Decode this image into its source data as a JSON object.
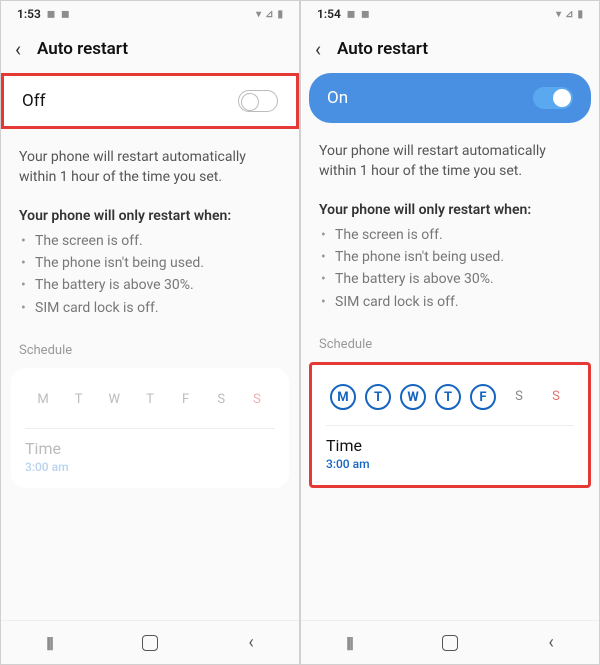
{
  "left": {
    "status_time": "1:53",
    "header_title": "Auto restart",
    "toggle_label": "Off",
    "description": "Your phone will restart automatically within 1 hour of the time you set.",
    "conditions_header": "Your phone will only restart when:",
    "conditions": [
      "The screen is off.",
      "The phone isn't being used.",
      "The battery is above 30%.",
      "SIM card lock is off."
    ],
    "schedule_label": "Schedule",
    "days": [
      "M",
      "T",
      "W",
      "T",
      "F",
      "S",
      "S"
    ],
    "time_label": "Time",
    "time_value": "3:00 am"
  },
  "right": {
    "status_time": "1:54",
    "header_title": "Auto restart",
    "toggle_label": "On",
    "description": "Your phone will restart automatically within 1 hour of the time you set.",
    "conditions_header": "Your phone will only restart when:",
    "conditions": [
      "The screen is off.",
      "The phone isn't being used.",
      "The battery is above 30%.",
      "SIM card lock is off."
    ],
    "schedule_label": "Schedule",
    "days": [
      "M",
      "T",
      "W",
      "T",
      "F",
      "S",
      "S"
    ],
    "selected_days": [
      true,
      true,
      true,
      true,
      true,
      false,
      false
    ],
    "time_label": "Time",
    "time_value": "3:00 am"
  }
}
